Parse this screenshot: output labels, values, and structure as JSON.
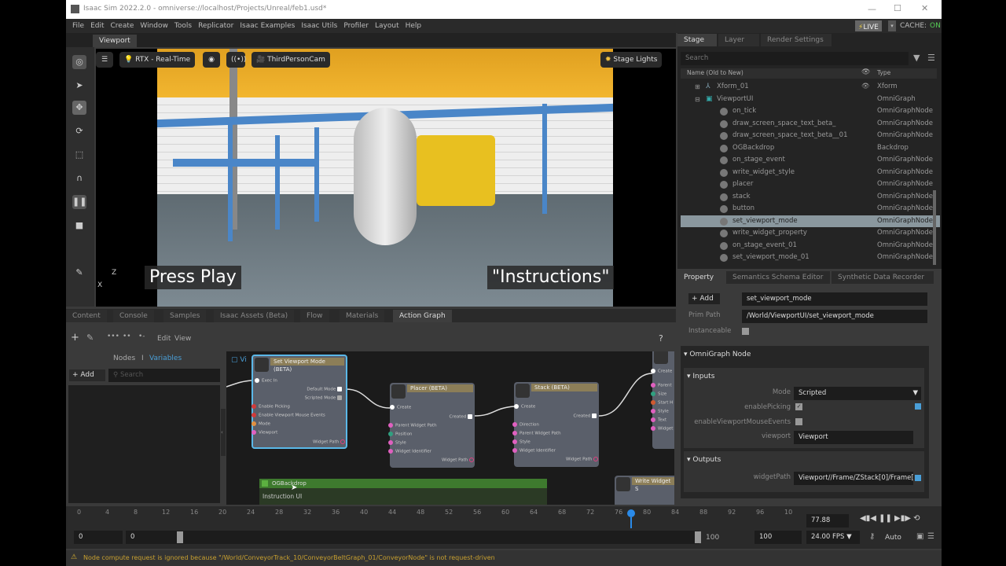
{
  "window": {
    "title": "Isaac Sim 2022.2.0 - omniverse://localhost/Projects/Unreal/feb1.usd*",
    "minimize": "—",
    "maximize": "☐",
    "close": "✕"
  },
  "menu": [
    "File",
    "Edit",
    "Create",
    "Window",
    "Tools",
    "Replicator",
    "Isaac Examples",
    "Isaac Utils",
    "Profiler",
    "Layout",
    "Help"
  ],
  "live": {
    "label": "LIVE",
    "cache_label": "CACHE:",
    "cache_state": "ON"
  },
  "viewport": {
    "tab": "Viewport",
    "renderer": "RTX - Real-Time",
    "camera": "ThirdPersonCam",
    "lights": "Stage Lights",
    "caption_left": "Press Play",
    "caption_right": "\"Instructions\"",
    "axis_z": "Z",
    "axis_x": "X"
  },
  "stage": {
    "tabs": [
      "Stage",
      "Layer",
      "Render Settings"
    ],
    "search_placeholder": "Search",
    "col_name": "Name (Old to New)",
    "col_type": "Type",
    "rows": [
      {
        "name": "Xform_01",
        "type": "Xform"
      },
      {
        "name": "ViewportUI",
        "type": "OmniGraph"
      },
      {
        "name": "on_tick",
        "type": "OmniGraphNode"
      },
      {
        "name": "draw_screen_space_text_beta_",
        "type": "OmniGraphNode"
      },
      {
        "name": "draw_screen_space_text_beta__01",
        "type": "OmniGraphNode"
      },
      {
        "name": "OGBackdrop",
        "type": "Backdrop"
      },
      {
        "name": "on_stage_event",
        "type": "OmniGraphNode"
      },
      {
        "name": "write_widget_style",
        "type": "OmniGraphNode"
      },
      {
        "name": "placer",
        "type": "OmniGraphNode"
      },
      {
        "name": "stack",
        "type": "OmniGraphNode"
      },
      {
        "name": "button",
        "type": "OmniGraphNode"
      },
      {
        "name": "set_viewport_mode",
        "type": "OmniGraphNode"
      },
      {
        "name": "write_widget_property",
        "type": "OmniGraphNode"
      },
      {
        "name": "on_stage_event_01",
        "type": "OmniGraphNode"
      },
      {
        "name": "set_viewport_mode_01",
        "type": "OmniGraphNode"
      }
    ]
  },
  "property": {
    "tabs": [
      "Property",
      "Semantics Schema Editor",
      "Synthetic Data Recorder"
    ],
    "add": "Add",
    "name_value": "set_viewport_mode",
    "prim_path_label": "Prim Path",
    "prim_path": "/World/ViewportUI/set_viewport_mode",
    "instanceable_label": "Instanceable",
    "section": "OmniGraph Node",
    "inputs": "Inputs",
    "mode_label": "Mode",
    "mode_value": "Scripted",
    "enable_picking": "enablePicking",
    "enable_mouse": "enableViewportMouseEvents",
    "viewport_label": "viewport",
    "viewport_value": "Viewport",
    "outputs": "Outputs",
    "widget_path_label": "widgetPath",
    "widget_path_value": "Viewport//Frame/ZStack[0]/Frame["
  },
  "bottom_tabs": [
    "Content",
    "Console",
    "Samples",
    "Isaac Assets (Beta)",
    "Flow",
    "Materials",
    "Action Graph"
  ],
  "graph": {
    "edit": "Edit",
    "view": "View",
    "help": "?",
    "nodes_tab": "Nodes",
    "sep": "I",
    "variables_tab": "Variables",
    "add": "Add",
    "search_placeholder": "Search",
    "graph_label": "Vi",
    "node1": {
      "title": "Set Viewport Mode (BETA)",
      "pins": [
        "Exec In",
        "Default Mode",
        "Scripted Mode",
        "Enable Picking",
        "Enable Viewport Mouse Events",
        "Mode",
        "Viewport",
        "Widget Path"
      ]
    },
    "node2": {
      "title": "Placer (BETA)",
      "pins": [
        "Create",
        "Created",
        "Parent Widget Path",
        "Position",
        "Style",
        "Widget Identifier",
        "Widget Path"
      ]
    },
    "node3": {
      "title": "Stack (BETA)",
      "pins": [
        "Create",
        "Created",
        "Direction",
        "Parent Widget Path",
        "Style",
        "Widget Identifier",
        "Widget Path"
      ]
    },
    "node4": {
      "pins": [
        "Create",
        "Parent",
        "Size",
        "Start H",
        "Style",
        "Text",
        "Widget"
      ]
    },
    "node5": {
      "title": "Write Widget S"
    },
    "backdrop": {
      "title": "OGBackdrop",
      "subtitle": "Instruction UI"
    }
  },
  "timeline": {
    "ticks": [
      "0",
      "4",
      "8",
      "12",
      "16",
      "20",
      "24",
      "28",
      "32",
      "36",
      "40",
      "44",
      "48",
      "52",
      "56",
      "60",
      "64",
      "68",
      "72",
      "76",
      "80",
      "84",
      "88",
      "92",
      "96",
      "10"
    ],
    "current_frame": "77.88",
    "current_fraction": 0.7788,
    "start": "0",
    "range_start": "0",
    "range_end": "100",
    "end": "100",
    "fps": "24.00 FPS",
    "auto": "Auto"
  },
  "status": {
    "message": "Node compute request is ignored because \"/World/ConveyorTrack_10/ConveyorBeltGraph_01/ConveyorNode\" is not request-driven"
  },
  "colors": {
    "accent": "#4a9fd8",
    "selected_row": "#8a979e",
    "warning": "#d8b030",
    "backdrop": "#3e7a2e"
  }
}
